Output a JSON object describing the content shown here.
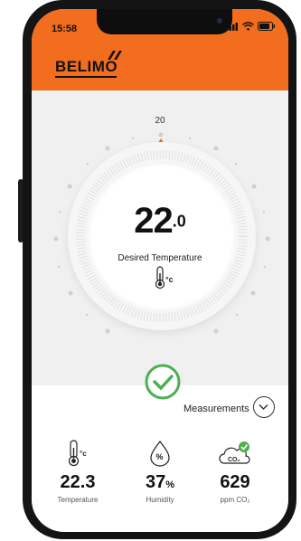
{
  "status_bar": {
    "time": "15:58"
  },
  "header": {
    "logo": "BELIMO"
  },
  "dial": {
    "top_label": "20",
    "value_int": "22",
    "value_dec": ".0",
    "desired_label": "Desired Temperature",
    "unit": "°c"
  },
  "measurements": {
    "label": "Measurements",
    "items": [
      {
        "icon": "thermometer-icon",
        "value": "22.3",
        "unit": "",
        "label": "Temperature",
        "unit_sym": "°c"
      },
      {
        "icon": "humidity-icon",
        "value": "37",
        "unit": "%",
        "label": "Humidity",
        "unit_sym": "%"
      },
      {
        "icon": "co2-cloud-icon",
        "value": "629",
        "unit": "",
        "label": "ppm CO₂",
        "unit_sym": "CO₂"
      }
    ]
  },
  "colors": {
    "brand": "#f26d1d",
    "ok": "#4caf50"
  }
}
